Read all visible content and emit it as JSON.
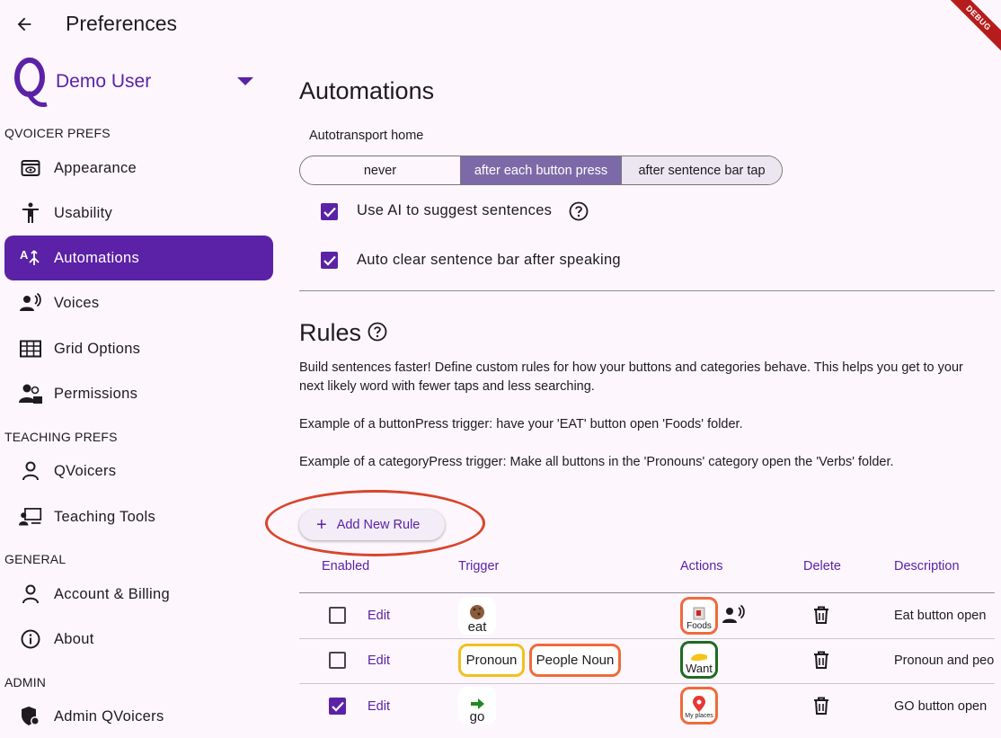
{
  "app_bar": {
    "title": "Preferences",
    "debug_label": "DEBUG"
  },
  "sidebar": {
    "user_name": "Demo User",
    "sections": {
      "qvoicer": "QVOICER PREFS",
      "teaching": "TEACHING PREFS",
      "general": "GENERAL",
      "admin": "ADMIN"
    },
    "items": {
      "appearance": "Appearance",
      "usability": "Usability",
      "automations": "Automations",
      "voices": "Voices",
      "grid_options": "Grid Options",
      "permissions": "Permissions",
      "qvoicers": "QVoicers",
      "teaching_tools": "Teaching Tools",
      "account_billing": "Account & Billing",
      "about": "About",
      "admin_qvoicers": "Admin QVoicers"
    },
    "active_item": "Automations"
  },
  "automations": {
    "heading": "Automations",
    "autotransport_label": "Autotransport home",
    "autotransport_options": [
      "never",
      "after each button press",
      "after sentence bar tap"
    ],
    "autotransport_selected": "after each button press",
    "use_ai_label": "Use AI to suggest sentences",
    "use_ai_checked": true,
    "auto_clear_label": "Auto clear sentence bar after speaking",
    "auto_clear_checked": true
  },
  "rules": {
    "heading": "Rules",
    "description": "Build sentences faster! Define custom rules for how your buttons and categories behave. This helps you get to your next likely word with fewer taps and less searching.",
    "example_button": "Example of a buttonPress trigger: have your 'EAT' button open 'Foods' folder.",
    "example_category": "Example of a categoryPress trigger: Make all buttons in the 'Pronouns' category open the 'Verbs' folder.",
    "add_button": "Add New Rule",
    "columns": [
      "Enabled",
      "Trigger",
      "Actions",
      "Delete",
      "Description"
    ],
    "edit_label": "Edit",
    "rows": [
      {
        "enabled": false,
        "triggers": [
          "eat"
        ],
        "actions": [
          "Foods",
          "speak-icon"
        ],
        "description": "Eat button open"
      },
      {
        "enabled": false,
        "triggers": [
          "Pronoun",
          "People Noun"
        ],
        "actions": [
          "Want"
        ],
        "description": "Pronoun and peo"
      },
      {
        "enabled": true,
        "triggers": [
          "go"
        ],
        "actions": [
          "My places"
        ],
        "description": "GO button open"
      }
    ]
  },
  "colors": {
    "primary": "#5b21a6",
    "segment_selected": "#7c6aa8",
    "highlight_circle": "#d9442b",
    "chip_orange": "#f06a3c",
    "chip_yellow": "#f2c01e",
    "chip_green": "#1e6b23"
  }
}
